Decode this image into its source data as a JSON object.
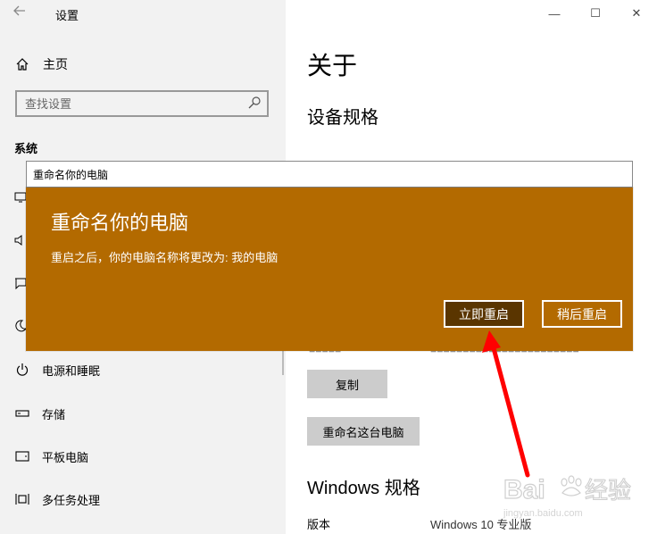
{
  "window": {
    "title": "设置",
    "back_icon": "arrow-left-icon",
    "controls": {
      "minimize": "—",
      "maximize": "☐",
      "close": "✕"
    }
  },
  "sidebar": {
    "home_label": "主页",
    "search_placeholder": "查找设置",
    "section_label": "系统",
    "items": [
      {
        "label": "电源和睡眠",
        "icon": "power-icon"
      },
      {
        "label": "存储",
        "icon": "storage-icon"
      },
      {
        "label": "平板电脑",
        "icon": "tablet-icon"
      },
      {
        "label": "多任务处理",
        "icon": "multitasking-icon"
      }
    ]
  },
  "main": {
    "page_title": "关于",
    "device_spec_title": "设备规格",
    "copy_button": "复制",
    "rename_button": "重命名这台电脑",
    "windows_spec_title": "Windows 规格",
    "version_label": "版本",
    "version_value": "Windows 10 专业版"
  },
  "dialog": {
    "input_value": "重命名你的电脑",
    "title": "重命名你的电脑",
    "message": "重启之后，你的电脑名称将更改为: 我的电脑",
    "restart_now": "立即重启",
    "restart_later": "稍后重启",
    "background_color": "#b36a00",
    "primary_button_color": "#5a3500"
  },
  "annotation": {
    "arrow_color": "#ff0000"
  },
  "watermark": {
    "brand": "Bai",
    "brand_cn": "经验",
    "url": "jingyan.baidu.com"
  }
}
